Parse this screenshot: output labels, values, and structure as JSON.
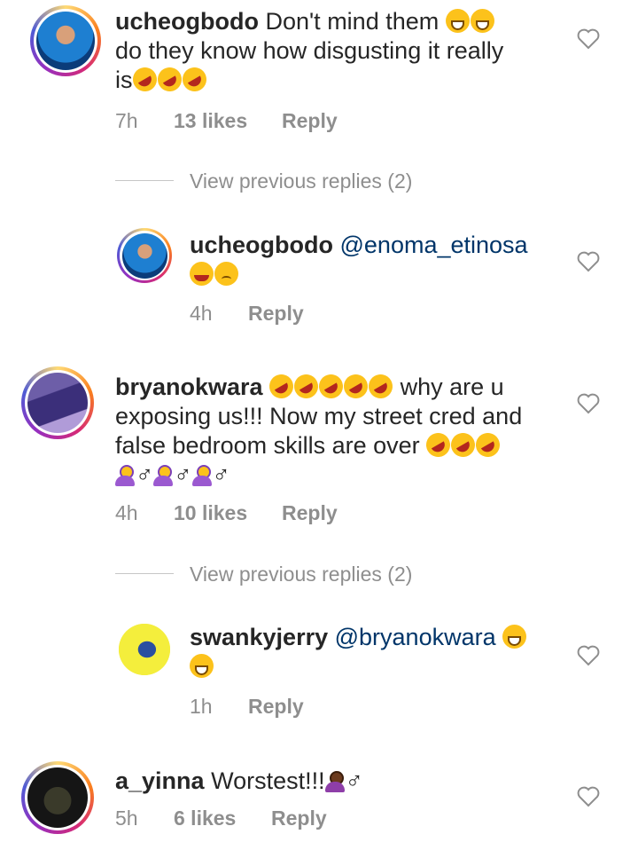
{
  "comments": [
    {
      "username": "ucheogbodo",
      "text_line1": "Don't mind them",
      "text_line2": "do they know how disgusting it really",
      "text_line3": "is",
      "time": "7h",
      "likes": "13 likes",
      "reply": "Reply",
      "view_prev": "View previous replies (2)"
    },
    {
      "username": "ucheogbodo",
      "mention": "@enoma_etinosa",
      "time": "4h",
      "reply": "Reply"
    },
    {
      "username": "bryanokwara",
      "text_line1": "why are u",
      "text_line2": "exposing us!!! Now my street cred and",
      "text_line3": "false bedroom skills are over",
      "time": "4h",
      "likes": "10 likes",
      "reply": "Reply",
      "view_prev": "View previous replies (2)"
    },
    {
      "username": "swankyjerry",
      "mention": "@bryanokwara",
      "time": "1h",
      "reply": "Reply"
    },
    {
      "username": "a_yinna",
      "text_line1": "Worstest!!!",
      "time": "5h",
      "likes": "6 likes",
      "reply": "Reply"
    }
  ],
  "male_sign": "♂",
  "icons": {
    "like": "heart-outline-icon",
    "emoji_grin": "grinning-squinting-face",
    "emoji_rofl": "rolling-on-floor-laughing",
    "emoji_sad": "frowning-face",
    "emoji_tired": "tired-face",
    "emoji_facepalm": "person-facepalming"
  },
  "colors": {
    "username": "#262626",
    "mention": "#003569",
    "meta": "#8e8e8e",
    "story_ring": "#d62976"
  }
}
